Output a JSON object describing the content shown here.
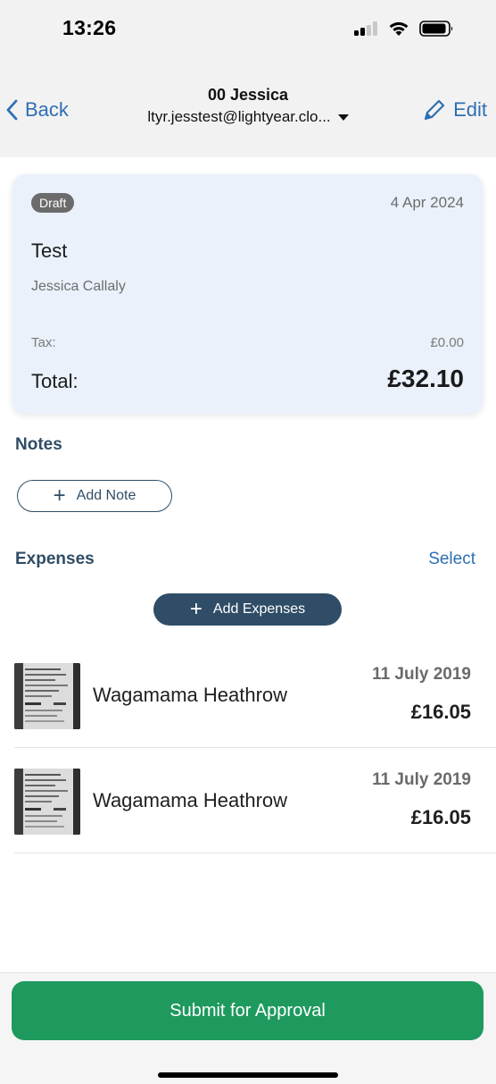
{
  "status_bar": {
    "time": "13:26",
    "signal_icon": "signal-bars-icon",
    "wifi_icon": "wifi-icon",
    "battery_icon": "battery-icon"
  },
  "nav": {
    "back_label": "Back",
    "back_icon": "chevron-left-icon",
    "title": "00 Jessica",
    "subtitle": "ltyr.jesstest@lightyear.clo...",
    "subtitle_icon": "caret-down-icon",
    "edit_label": "Edit",
    "edit_icon": "pencil-icon",
    "accent_color": "#2e6fb3"
  },
  "report_card": {
    "status_badge": "Draft",
    "date": "4 Apr 2024",
    "title": "Test",
    "person": "Jessica Callaly",
    "tax_label": "Tax:",
    "tax_value": "£0.00",
    "total_label": "Total:",
    "total_value": "£32.10",
    "background_color": "#eaf1fb"
  },
  "notes": {
    "heading": "Notes",
    "add_button_label": "Add Note",
    "add_icon": "plus-icon"
  },
  "expenses": {
    "heading": "Expenses",
    "select_label": "Select",
    "add_button_label": "Add Expenses",
    "add_icon": "plus-icon",
    "items": [
      {
        "name": "Wagamama Heathrow",
        "date": "11 July 2019",
        "amount": "£16.05",
        "thumbnail": "receipt-thumbnail"
      },
      {
        "name": "Wagamama Heathrow",
        "date": "11 July 2019",
        "amount": "£16.05",
        "thumbnail": "receipt-thumbnail"
      }
    ]
  },
  "footer": {
    "submit_label": "Submit for Approval",
    "submit_color": "#1f9a5e"
  }
}
